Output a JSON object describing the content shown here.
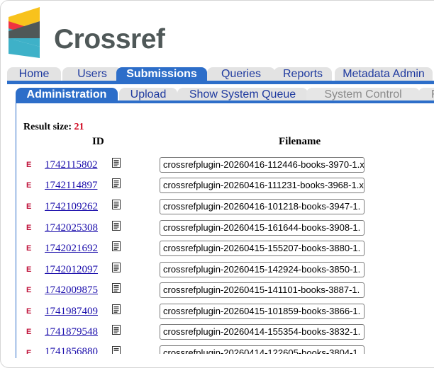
{
  "brand": {
    "name": "Crossref"
  },
  "main_tabs": [
    {
      "label": "Home"
    },
    {
      "label": "Users"
    },
    {
      "label": "Submissions",
      "active": true
    },
    {
      "label": "Queries"
    },
    {
      "label": "Reports"
    },
    {
      "label": "Metadata Admin"
    }
  ],
  "sub_tabs": [
    {
      "label": "Administration",
      "active": true
    },
    {
      "label": "Upload"
    },
    {
      "label": "Show System Queue"
    },
    {
      "label": "System Control",
      "disabled": true
    },
    {
      "label": "Fu",
      "disabled": true
    }
  ],
  "results": {
    "label": "Result size:",
    "count": "21",
    "col_id": "ID",
    "col_filename": "Filename",
    "rows": [
      {
        "type": "E",
        "id": "1742115802",
        "filename": "crossrefplugin-20260416-112446-books-3970-1.x"
      },
      {
        "type": "E",
        "id": "1742114897",
        "filename": "crossrefplugin-20260416-111231-books-3968-1.x"
      },
      {
        "type": "E",
        "id": "1742109262",
        "filename": "crossrefplugin-20260416-101218-books-3947-1."
      },
      {
        "type": "E",
        "id": "1742025308",
        "filename": "crossrefplugin-20260415-161644-books-3908-1."
      },
      {
        "type": "E",
        "id": "1742021692",
        "filename": "crossrefplugin-20260415-155207-books-3880-1."
      },
      {
        "type": "E",
        "id": "1742012097",
        "filename": "crossrefplugin-20260415-142924-books-3850-1."
      },
      {
        "type": "E",
        "id": "1742009875",
        "filename": "crossrefplugin-20260415-141101-books-3887-1."
      },
      {
        "type": "E",
        "id": "1741987409",
        "filename": "crossrefplugin-20260415-101859-books-3866-1."
      },
      {
        "type": "E",
        "id": "1741879548",
        "filename": "crossrefplugin-20260414-155354-books-3832-1."
      },
      {
        "type": "E",
        "id": "1741856880",
        "filename": "crossrefplugin-20260414-122605-books-3804-1."
      }
    ]
  },
  "colors": {
    "tab_active": "#2d6ec9",
    "tab_inactive": "#e3e3e3",
    "link": "#1a0dab",
    "count": "#d0021b",
    "e_icon": "#c0143c"
  }
}
